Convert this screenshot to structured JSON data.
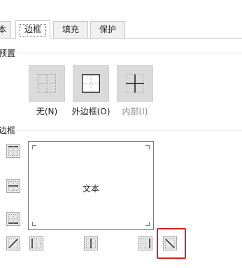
{
  "tabs": [
    {
      "label": "本"
    },
    {
      "label": "边框"
    },
    {
      "label": "填充"
    },
    {
      "label": "保护"
    }
  ],
  "presets_section": {
    "title": "预置"
  },
  "presets": [
    {
      "label": "无(N)",
      "icon": "border-none-icon"
    },
    {
      "label": "外边框(O)",
      "icon": "border-outline-icon"
    },
    {
      "label": "内部(I)",
      "icon": "border-inside-icon",
      "disabled": true
    }
  ],
  "border_section": {
    "title": "边框"
  },
  "preview": {
    "text": "文本"
  },
  "colors": {
    "highlight": "#e02020",
    "button_face": "#dadada"
  }
}
